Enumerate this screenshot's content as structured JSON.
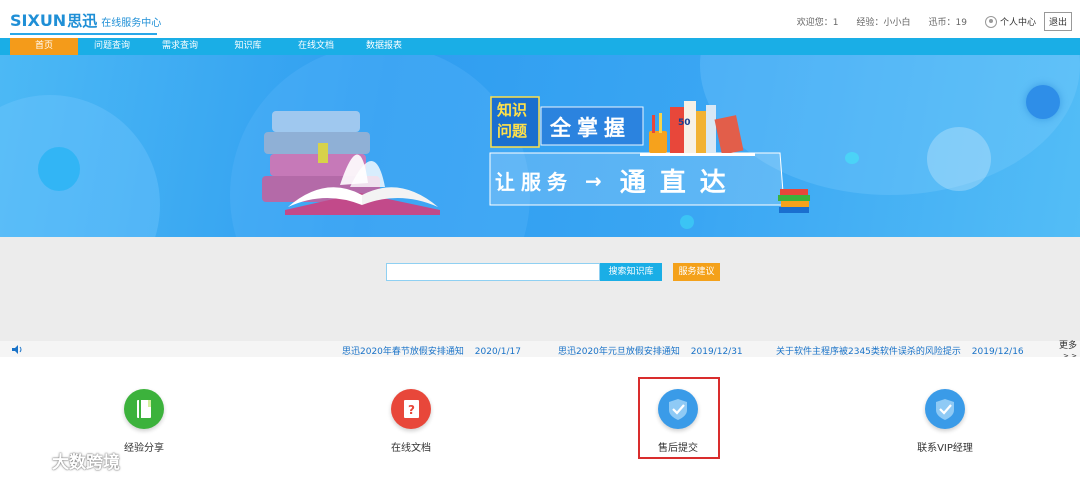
{
  "header": {
    "brand": "SIXUN",
    "brand_cn": "思迅",
    "subtitle": "在线服务中心",
    "welcome": "欢迎您：1",
    "experience": "经验：小小白",
    "coins": "迅币：19",
    "user_center": "个人中心",
    "logout": "退出"
  },
  "nav": {
    "items": [
      "首页",
      "问题查询",
      "需求查询",
      "知识库",
      "在线文档",
      "数据报表"
    ]
  },
  "banner": {
    "tag_line1": "知识",
    "tag_line2": "问题",
    "slogan_main": "全掌握",
    "slogan_left": "让服务",
    "slogan_arrow": "→",
    "slogan_right": "通直达",
    "book_label": "50"
  },
  "search": {
    "placeholder": "",
    "search_button": "搜索知识库",
    "suggest_button": "服务建议"
  },
  "notices": [
    {
      "title": "思迅2020年春节放假安排通知",
      "date": "2020/1/17"
    },
    {
      "title": "思迅2020年元旦放假安排通知",
      "date": "2019/12/31"
    },
    {
      "title": "关于软件主程序被2345类软件误杀的风险提示",
      "date": "2019/12/16"
    }
  ],
  "more": {
    "label": "更多",
    "arrows": "> >"
  },
  "features": [
    {
      "label": "经验分享",
      "icon": "book-icon",
      "color": "#3cb23c"
    },
    {
      "label": "在线文档",
      "icon": "document-question-icon",
      "color": "#e8473a"
    },
    {
      "label": "售后提交",
      "icon": "shield-check-icon",
      "color": "#3a9be8"
    },
    {
      "label": "联系VIP经理",
      "icon": "shield-check-icon",
      "color": "#3a9be8"
    }
  ],
  "watermark": "大数跨境",
  "colors": {
    "primary": "#1aaee6",
    "accent": "#f49b1a",
    "highlight": "#d92d2d"
  }
}
